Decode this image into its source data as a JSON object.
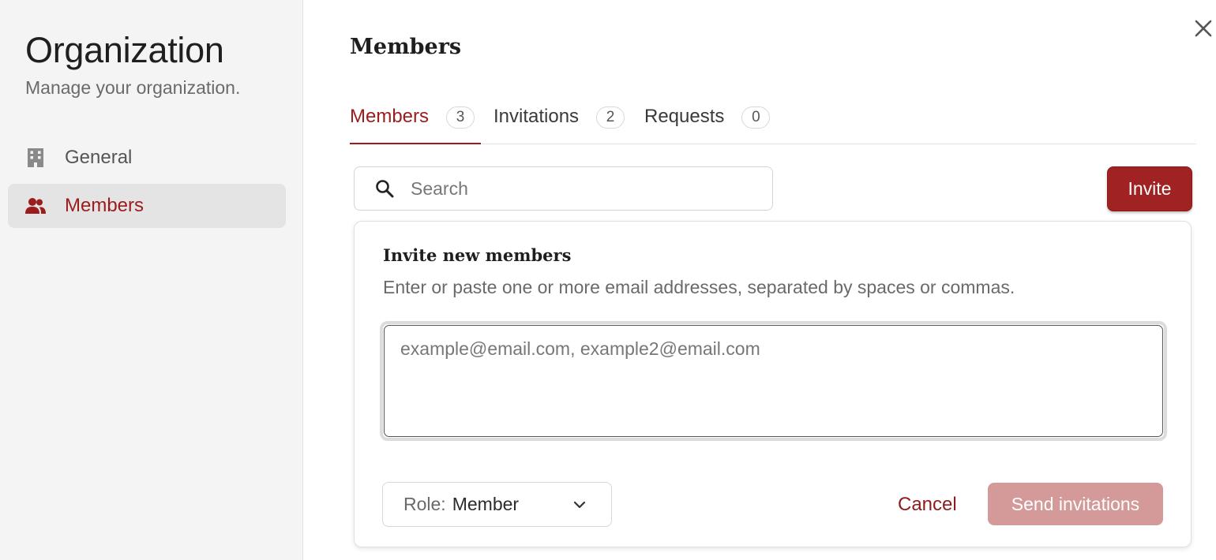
{
  "sidebar": {
    "title": "Organization",
    "subtitle": "Manage your organization.",
    "items": [
      {
        "label": "General",
        "icon": "building-icon",
        "active": false
      },
      {
        "label": "Members",
        "icon": "users-icon",
        "active": true
      }
    ]
  },
  "main": {
    "title": "Members",
    "tabs": [
      {
        "label": "Members",
        "count": "3",
        "active": true
      },
      {
        "label": "Invitations",
        "count": "2",
        "active": false
      },
      {
        "label": "Requests",
        "count": "0",
        "active": false
      }
    ],
    "search": {
      "placeholder": "Search",
      "value": ""
    },
    "invite_button": "Invite"
  },
  "invite_panel": {
    "title": "Invite new members",
    "description": "Enter or paste one or more email addresses, separated by spaces or commas.",
    "emails_placeholder": "example@email.com, example2@email.com",
    "emails_value": "",
    "role_prefix": "Role:",
    "role_value": "Member",
    "cancel_label": "Cancel",
    "send_label": "Send invitations"
  },
  "colors": {
    "accent": "#9b1c1c",
    "primary_button": "#a02222",
    "disabled_button": "#d49a9a",
    "sidebar_bg": "#f4f4f4",
    "active_item_bg": "#e4e4e4"
  }
}
